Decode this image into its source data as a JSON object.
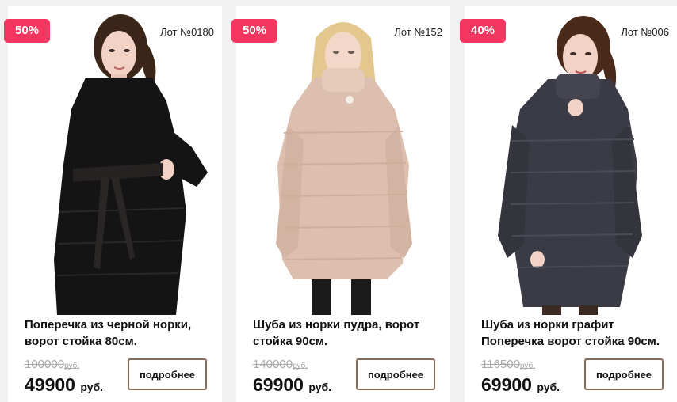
{
  "products": [
    {
      "discount": "50%",
      "lot": "Лот №0180",
      "title": "Поперечка из черной норки, ворот стойка 80см.",
      "old_price": "100000",
      "old_currency": "руб.",
      "new_price": "49900",
      "new_currency": "руб.",
      "button": "подробнее",
      "coat_color": "#151414",
      "hair_color": "#3a2518"
    },
    {
      "discount": "50%",
      "lot": "Лот №152",
      "title": "Шуба из норки пудра, ворот стойка 90см.",
      "old_price": "140000",
      "old_currency": "руб.",
      "new_price": "69900",
      "new_currency": "руб.",
      "button": "подробнее",
      "coat_color": "#dcbfae",
      "hair_color": "#e3c78f"
    },
    {
      "discount": "40%",
      "lot": "Лот №006",
      "title": "Шуба из норки графит Поперечка ворот стойка 90см.",
      "old_price": "116500",
      "old_currency": "руб.",
      "new_price": "69900",
      "new_currency": "руб.",
      "button": "подробнее",
      "coat_color": "#3a3b44",
      "hair_color": "#4a2a1a"
    }
  ],
  "colors": {
    "badge": "#f2365f",
    "button_border": "#8a6a54",
    "old_price": "#a8a8a8"
  }
}
